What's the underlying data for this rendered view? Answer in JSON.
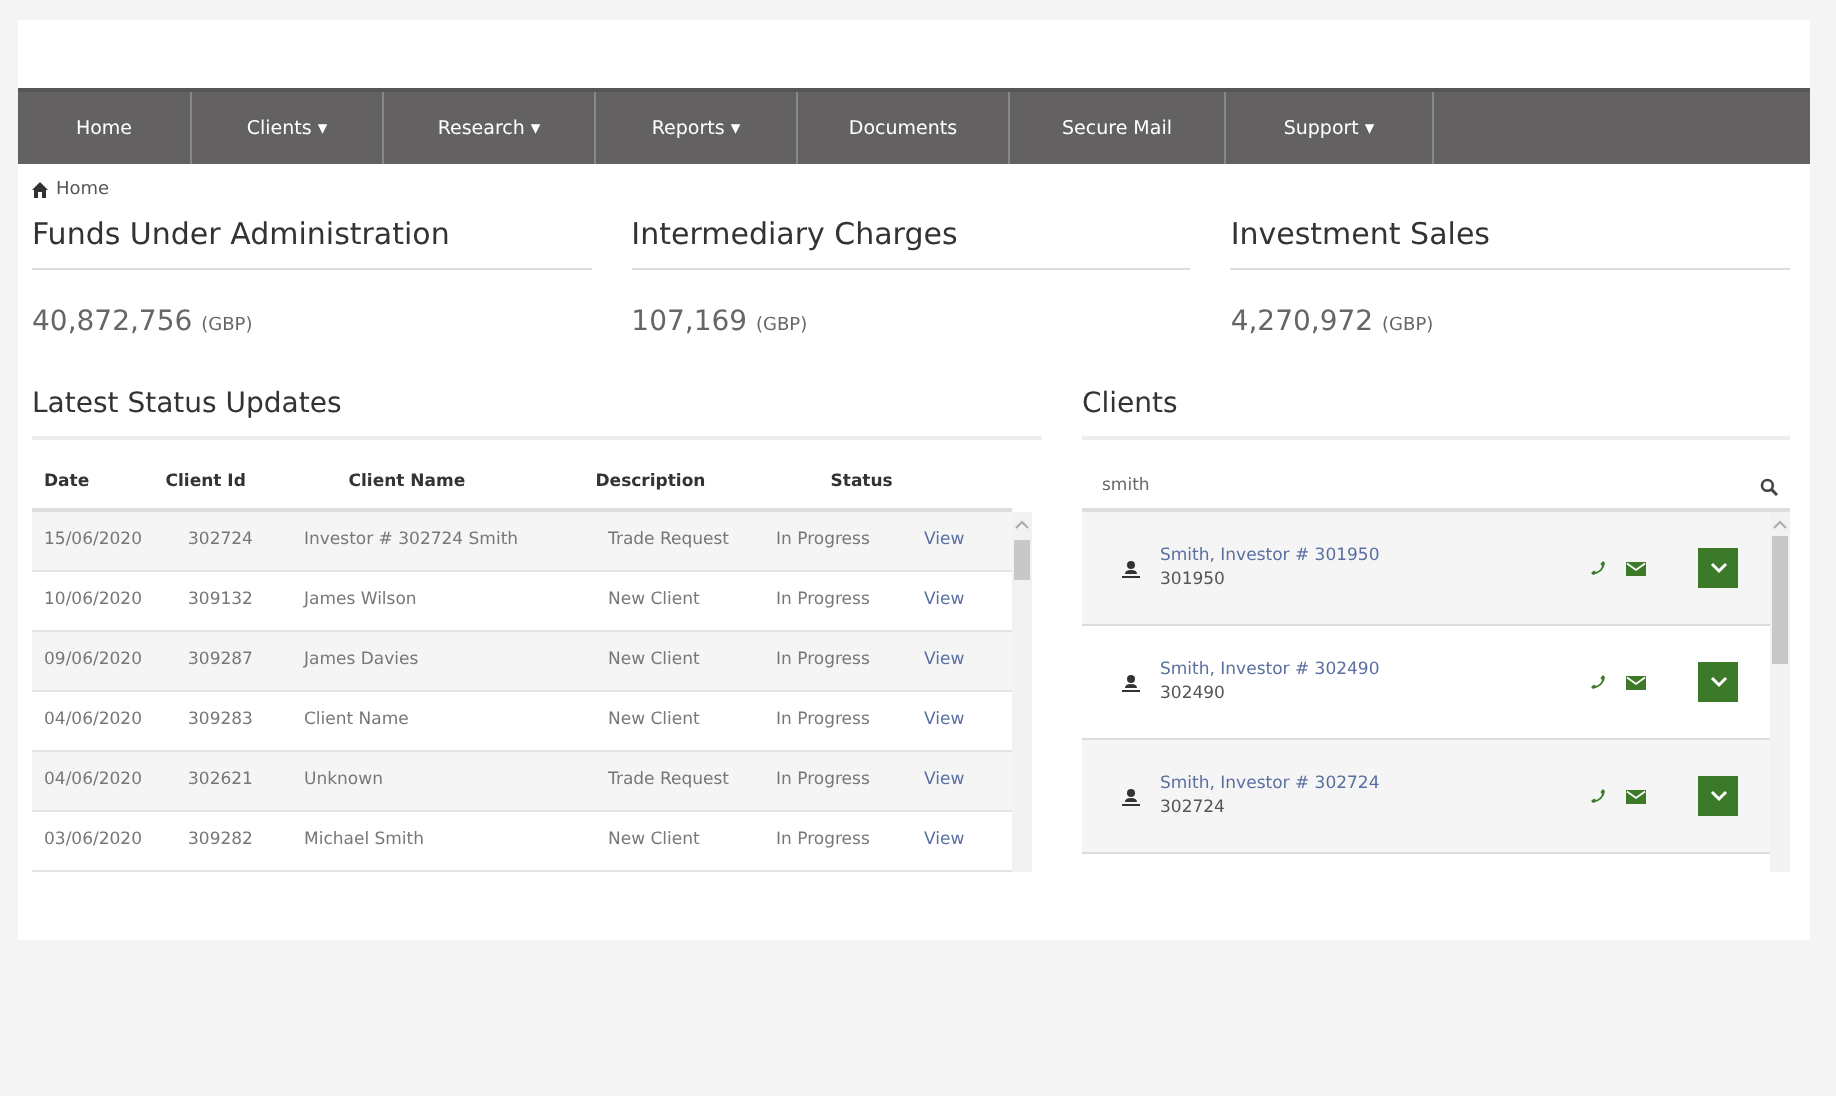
{
  "nav": [
    {
      "label": "Home"
    },
    {
      "label": "Clients ▾"
    },
    {
      "label": "Research ▾"
    },
    {
      "label": "Reports ▾"
    },
    {
      "label": "Documents"
    },
    {
      "label": "Secure Mail"
    },
    {
      "label": "Support ▾"
    }
  ],
  "breadcrumb": "Home",
  "metrics": [
    {
      "title": "Funds Under Administration",
      "value": "40,872,756",
      "unit": "(GBP)"
    },
    {
      "title": "Intermediary Charges",
      "value": "107,169",
      "unit": "(GBP)"
    },
    {
      "title": "Investment Sales",
      "value": "4,270,972",
      "unit": "(GBP)"
    }
  ],
  "status_updates": {
    "title": "Latest Status Updates",
    "columns": [
      "Date",
      "Client Id",
      "Client Name",
      "Description",
      "Status"
    ],
    "rows": [
      {
        "cells": [
          "15/06/2020",
          "302724",
          "Investor # 302724 Smith",
          "Trade Request",
          "In Progress"
        ],
        "link": "View"
      },
      {
        "cells": [
          "10/06/2020",
          "309132",
          "James Wilson",
          "New Client",
          "In Progress"
        ],
        "link": "View"
      },
      {
        "cells": [
          "09/06/2020",
          "309287",
          "James Davies",
          "New Client",
          "In Progress"
        ],
        "link": "View"
      },
      {
        "cells": [
          "04/06/2020",
          "309283",
          "Client Name",
          "New Client",
          "In Progress"
        ],
        "link": "View"
      },
      {
        "cells": [
          "04/06/2020",
          "302621",
          "Unknown",
          "Trade Request",
          "In Progress"
        ],
        "link": "View"
      },
      {
        "cells": [
          "03/06/2020",
          "309282",
          "Michael Smith",
          "New Client",
          "In Progress"
        ],
        "link": "View"
      }
    ]
  },
  "clients": {
    "title": "Clients",
    "search": "smith",
    "items": [
      {
        "name": "Smith, Investor # 301950",
        "id": "301950"
      },
      {
        "name": "Smith, Investor # 302490",
        "id": "302490"
      },
      {
        "name": "Smith, Investor # 302724",
        "id": "302724"
      }
    ]
  }
}
